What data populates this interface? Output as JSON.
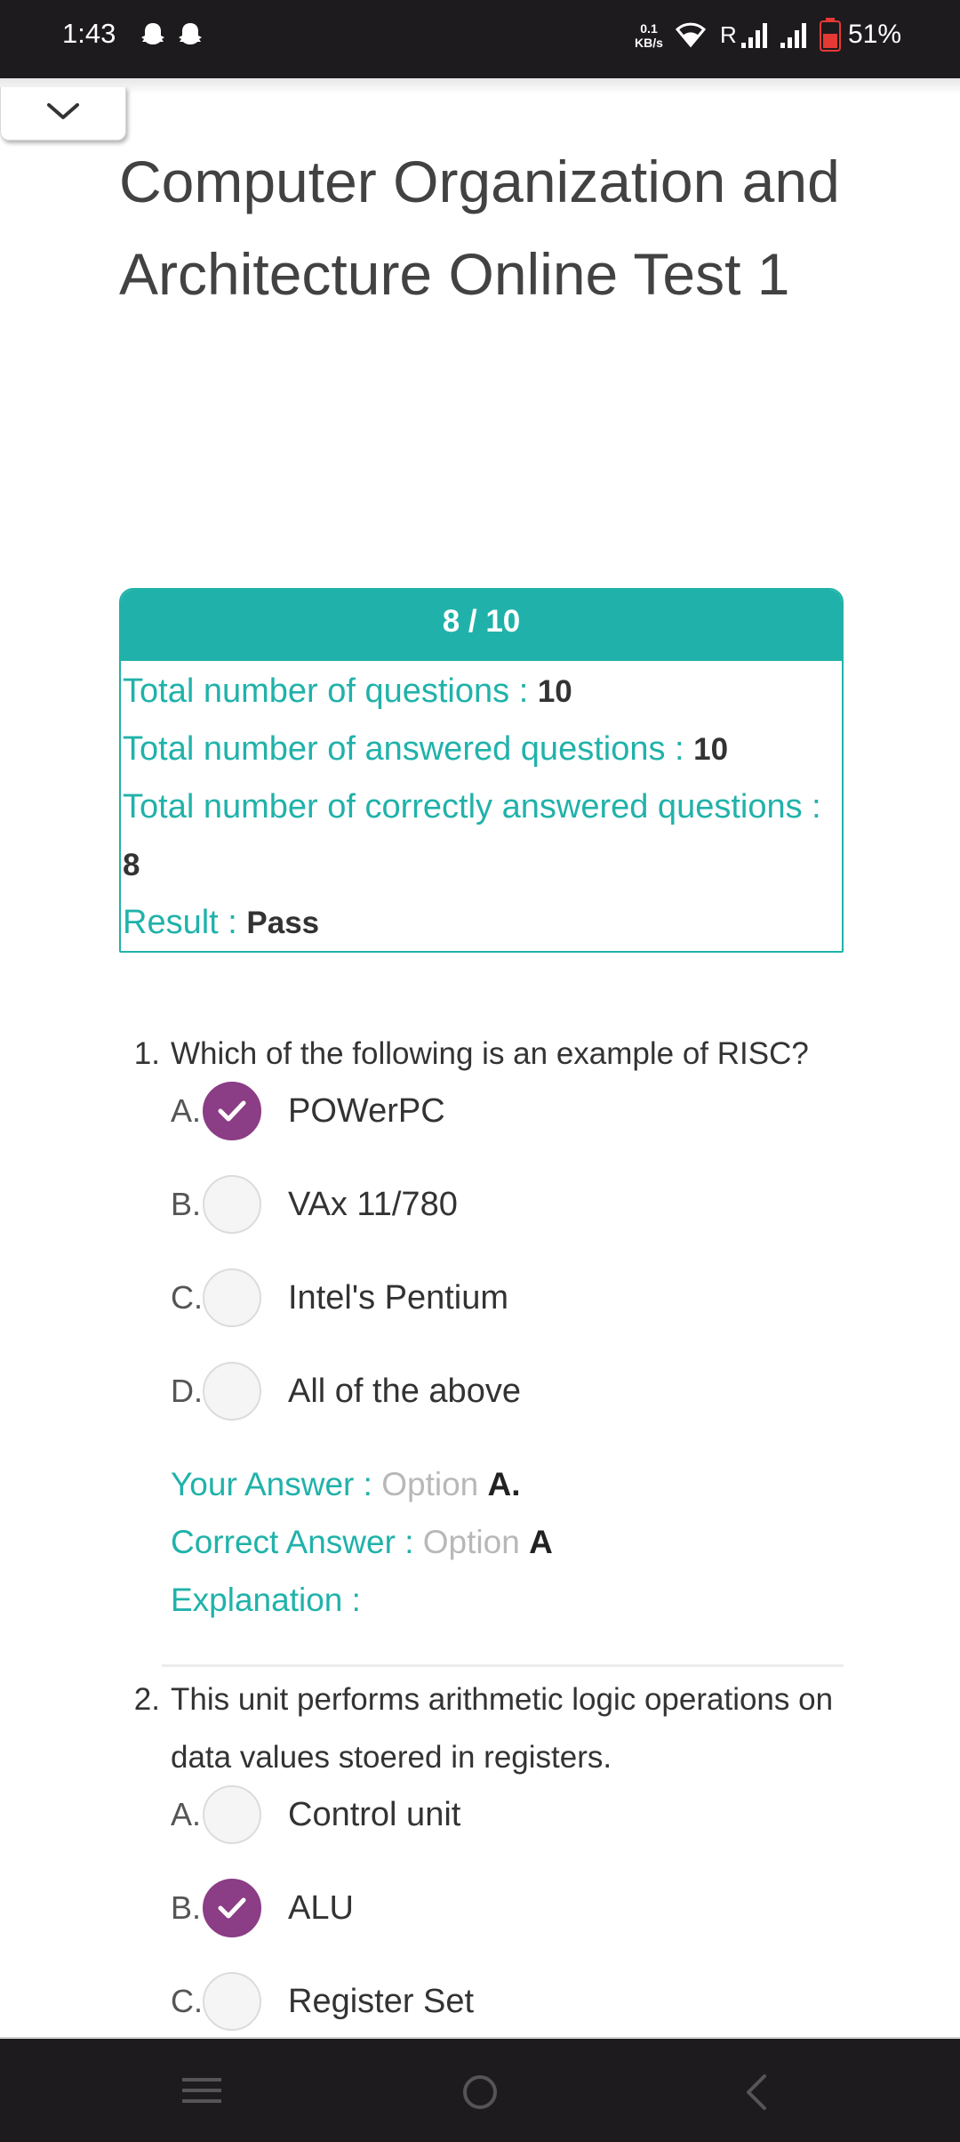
{
  "status_bar": {
    "time": "1:43",
    "net_speed_value": "0.1",
    "net_speed_unit": "KB/s",
    "roaming": "R",
    "battery": "51%",
    "icons": [
      "snapchat-ghost-icon",
      "snapchat-ghost-icon",
      "wifi-icon",
      "signal-icon",
      "signal-icon",
      "battery-icon"
    ]
  },
  "page": {
    "title": "Computer Organization and Architecture Online Test 1"
  },
  "result": {
    "score": "8 / 10",
    "total_label": "Total number of questions : ",
    "total_value": "10",
    "answered_label": "Total number of answered questions : ",
    "answered_value": "10",
    "correct_label": "Total number of correctly answered questions : ",
    "correct_value": "8",
    "result_label": "Result : ",
    "result_value": "Pass"
  },
  "questions": [
    {
      "number": "1.",
      "text": "Which of the following is an example of RISC?",
      "options": [
        {
          "letter": "A.",
          "text": "POWerPC",
          "checked": true
        },
        {
          "letter": "B.",
          "text": "VAx 11/780",
          "checked": false
        },
        {
          "letter": "C.",
          "text": "Intel's Pentium",
          "checked": false
        },
        {
          "letter": "D.",
          "text": "All of the above",
          "checked": false
        }
      ],
      "your_answer_label": "Your Answer : ",
      "your_answer_option": "Option ",
      "your_answer_value": "A.",
      "correct_answer_label": "Correct Answer : ",
      "correct_answer_option": "Option ",
      "correct_answer_value": "A",
      "explanation_label": "Explanation :"
    },
    {
      "number": "2.",
      "text": "This unit performs arithmetic logic operations on data values stoered in registers.",
      "options": [
        {
          "letter": "A.",
          "text": "Control unit",
          "checked": false
        },
        {
          "letter": "B.",
          "text": "ALU",
          "checked": true
        },
        {
          "letter": "C.",
          "text": "Register Set",
          "checked": false
        }
      ]
    }
  ],
  "colors": {
    "accent_teal": "#20b2aa",
    "checked_purple": "#8b3d85",
    "status_bar_bg": "#1e1b1e",
    "battery_red": "#e53935"
  }
}
